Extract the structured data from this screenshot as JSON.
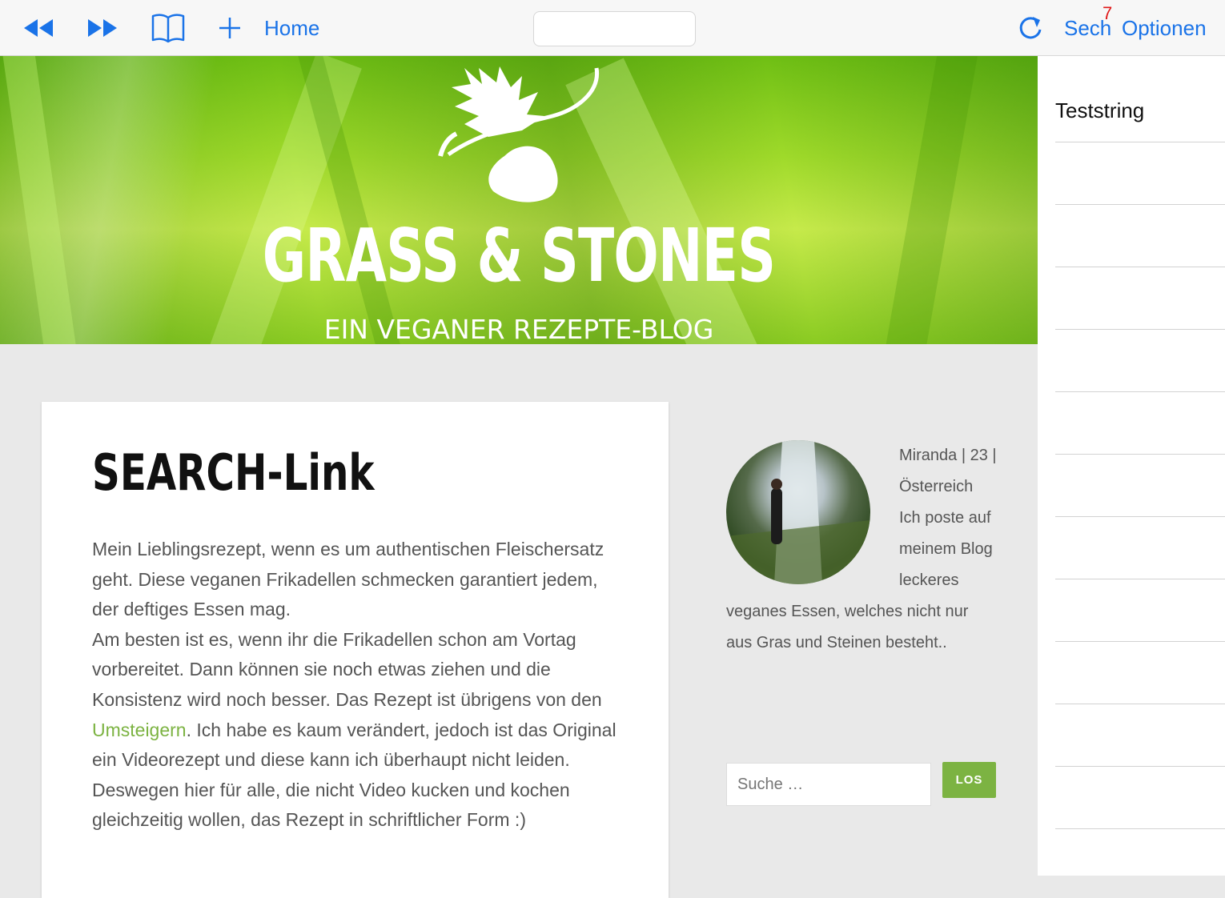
{
  "toolbar": {
    "home_label": "Home",
    "address_value": "",
    "search_label": "Sech",
    "badge_count": "7",
    "options_label": "Optionen",
    "accent_color": "#1a73e8"
  },
  "banner": {
    "title": "GRASS & STONES",
    "subtitle": "EIN VEGANER REZEPTE-BLOG"
  },
  "side_panel": {
    "items": [
      "Teststring",
      "",
      "",
      "",
      "",
      "",
      "",
      "",
      "",
      "",
      "",
      "",
      ""
    ]
  },
  "post": {
    "title": "SEARCH-Link",
    "para1": "Mein Lieblingsrezept, wenn es um authentischen Fleischersatz geht. Diese veganen Frikadellen schmecken garantiert jedem, der deftiges Essen mag.",
    "para2_before": "Am besten ist es, wenn ihr die Frikadellen schon am Vortag vorbereitet. Dann können sie noch etwas ziehen und die Konsistenz wird noch besser. Das Rezept ist übrigens von den ",
    "para2_link": "Umsteigern",
    "para2_after": ". Ich habe es kaum verändert, jedoch ist das Original ein Videorezept und diese kann ich überhaupt nicht leiden. Deswegen hier für alle, die nicht Video kucken und kochen gleichzeitig wollen, das Rezept in schriftlicher Form :)"
  },
  "about": {
    "text": "Miranda | 23 | Österreich Ich poste auf meinem Blog leckeres veganes Essen, welches nicht nur aus Gras und Steinen besteht.."
  },
  "search": {
    "placeholder": "Suche …",
    "button_label": "LOS"
  }
}
